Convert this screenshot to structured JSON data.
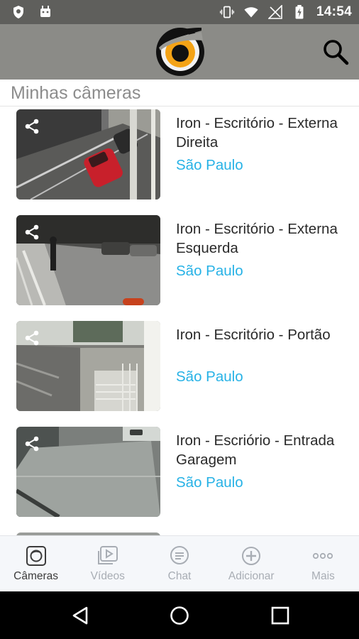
{
  "status_bar": {
    "time": "14:54",
    "colors": {
      "background": "#5f5f5c"
    }
  },
  "header": {
    "logo_icon": "owl-eye-logo",
    "search_icon": "search-icon",
    "colors": {
      "background": "#8b8b87"
    }
  },
  "section": {
    "title": "Minhas câmeras"
  },
  "cameras": [
    {
      "name": "Iron - Escritório - Externa Direita",
      "city": "São Paulo",
      "scene": "street-red-car"
    },
    {
      "name": "Iron - Escritório - Externa Esquerda",
      "city": "São Paulo",
      "scene": "sidewalk-left"
    },
    {
      "name": "Iron - Escritório - Portão",
      "city": "São Paulo",
      "scene": "gate-stairs"
    },
    {
      "name": "Iron - Escriório - Entrada Garagem",
      "city": "São Paulo",
      "scene": "garage-entrance"
    }
  ],
  "bottom_nav": [
    {
      "label": "Câmeras",
      "icon": "camera-icon",
      "active": true
    },
    {
      "label": "Vídeos",
      "icon": "video-icon",
      "active": false
    },
    {
      "label": "Chat",
      "icon": "chat-icon",
      "active": false
    },
    {
      "label": "Adicionar",
      "icon": "add-icon",
      "active": false
    },
    {
      "label": "Mais",
      "icon": "more-icon",
      "active": false
    }
  ],
  "colors": {
    "accent": "#27b2e6",
    "section_title": "#8c8c8c",
    "nav_inactive": "#a8adb4",
    "nav_active": "#3c3c3c"
  }
}
